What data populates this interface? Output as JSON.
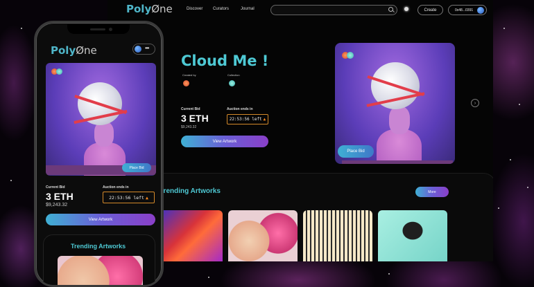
{
  "desktop": {
    "logo": {
      "brand": "Poly",
      "suffix": "ne",
      "o_char": "Ø"
    },
    "nav": [
      "Discover",
      "Curators",
      "Journal"
    ],
    "search": {
      "placeholder": ""
    },
    "create_label": "Create",
    "wallet_label": "0x48...0391",
    "hero": {
      "title": "Cloud Me !",
      "created_by_label": "Created by",
      "collection_label": "Collection",
      "current_bid_label": "Current Bid",
      "current_bid_value": "3 ETH",
      "current_bid_usd": "$9,243.32",
      "auction_label": "Auction ends in",
      "timer": "22:53:56 left",
      "view_artwork_label": "View Artwork",
      "place_bid_label": "Place Bid",
      "next_arrow": "›"
    },
    "trending": {
      "title": "Trending Artworks",
      "more_label": "More"
    }
  },
  "phone": {
    "logo": {
      "brand": "Poly",
      "suffix": "ne",
      "o_char": "Ø"
    },
    "menu_dots": "•••",
    "place_bid_label": "Place Bid",
    "current_bid_label": "Current Bid",
    "current_bid_value": "3 ETH",
    "current_bid_usd": "$9,243.32",
    "auction_label": "Auction ends in",
    "timer": "22:53:56 left",
    "view_artwork_label": "View Artwork",
    "trending_title": "Trending Artworks"
  },
  "colors": {
    "accent": "#4ec9d4",
    "button_gradient_start": "#3fb0d4",
    "button_gradient_end": "#8a3fc8",
    "timer_border": "#d58a2a",
    "background": "#050505"
  }
}
